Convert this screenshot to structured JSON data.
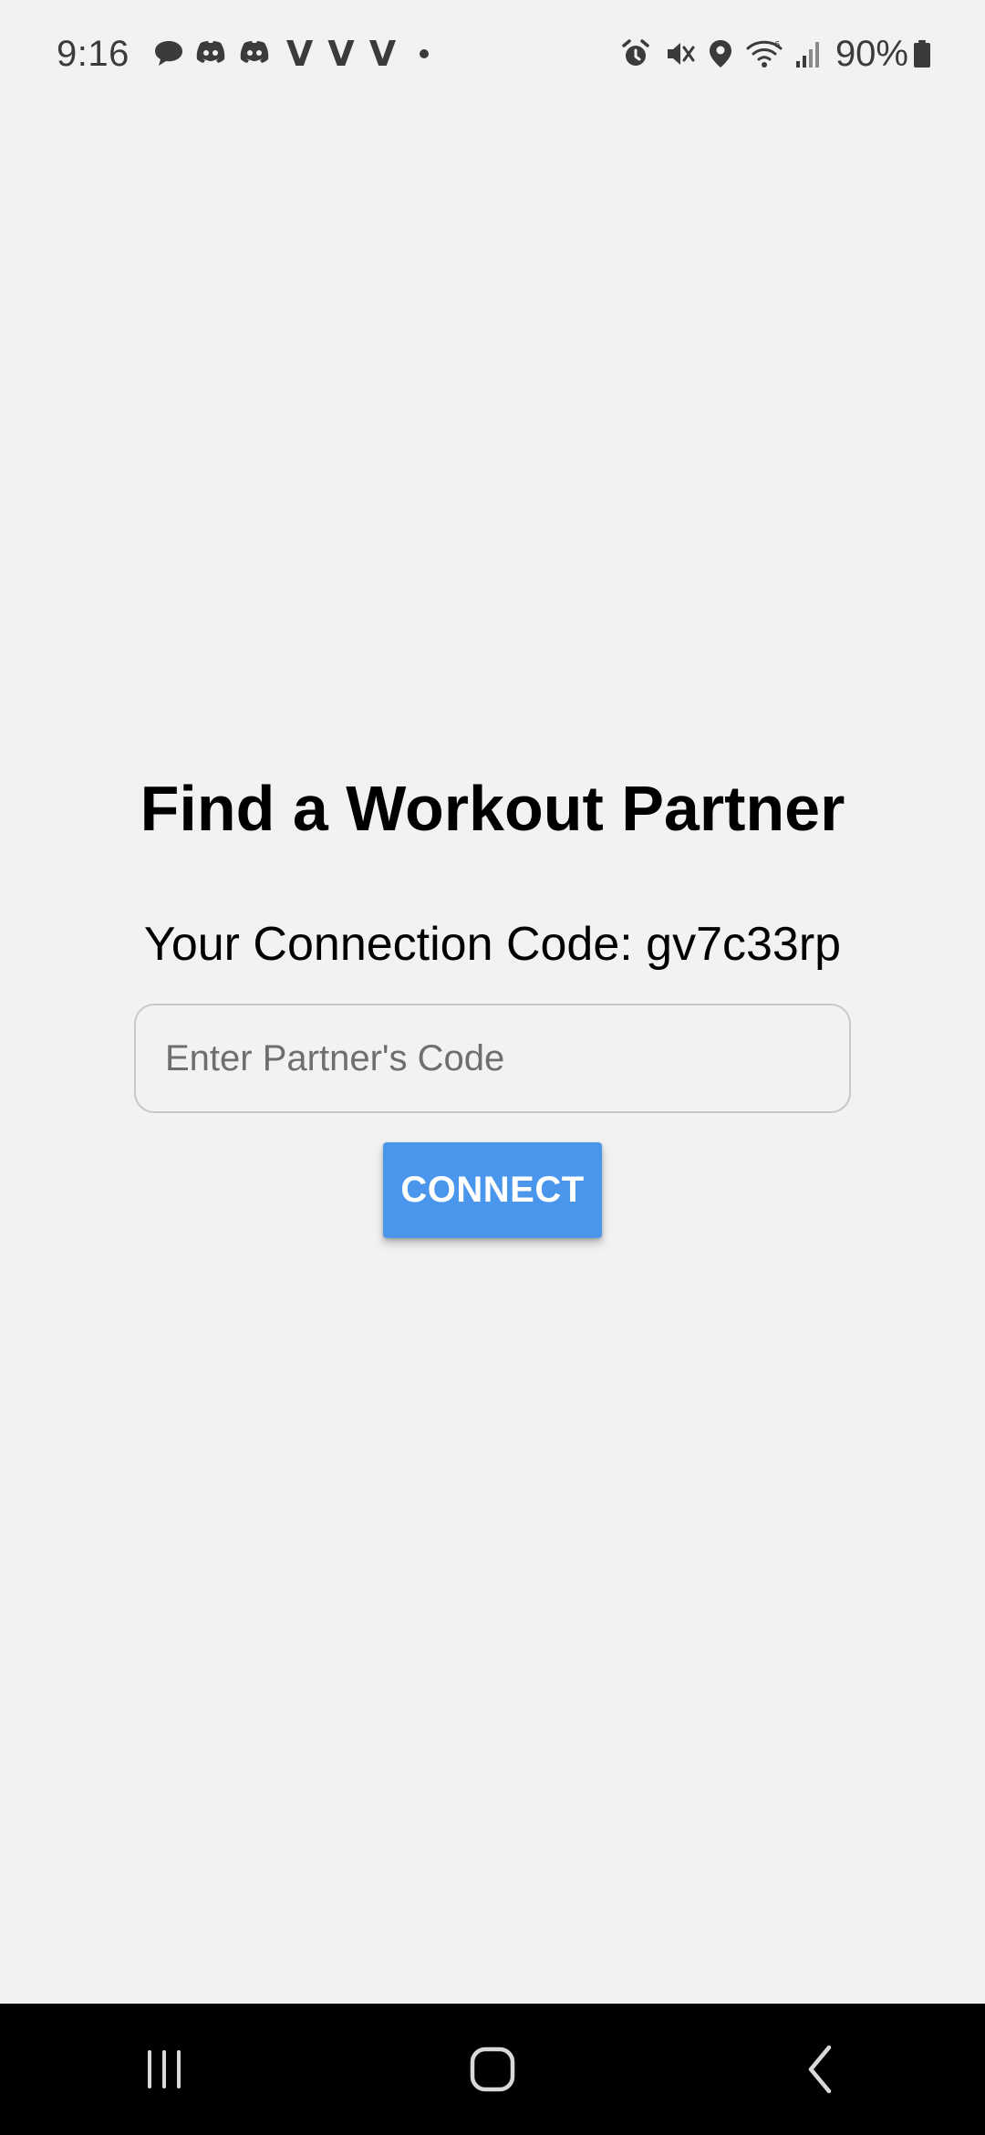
{
  "status_bar": {
    "time": "9:16",
    "battery": "90%",
    "notification_icons": [
      "chat-bubble-icon",
      "discord-icon",
      "discord-icon",
      "v-icon",
      "v-icon",
      "v-icon",
      "more-dot-icon"
    ],
    "v_label": "V",
    "system_icons": [
      "alarm-icon",
      "mute-icon",
      "location-icon",
      "wifi-icon",
      "signal-icon",
      "battery-icon"
    ]
  },
  "main": {
    "title": "Find a Workout Partner",
    "connection_code_line": "Your Connection Code: gv7c33rp",
    "partner_code_input": {
      "value": "",
      "placeholder": "Enter Partner's Code"
    },
    "connect_label": "CONNECT"
  },
  "nav_bar": {
    "buttons": [
      "recents-icon",
      "home-icon",
      "back-icon"
    ]
  },
  "colors": {
    "background": "#f2f2f2",
    "accent": "#4a96ec",
    "nav_background": "#000000"
  }
}
